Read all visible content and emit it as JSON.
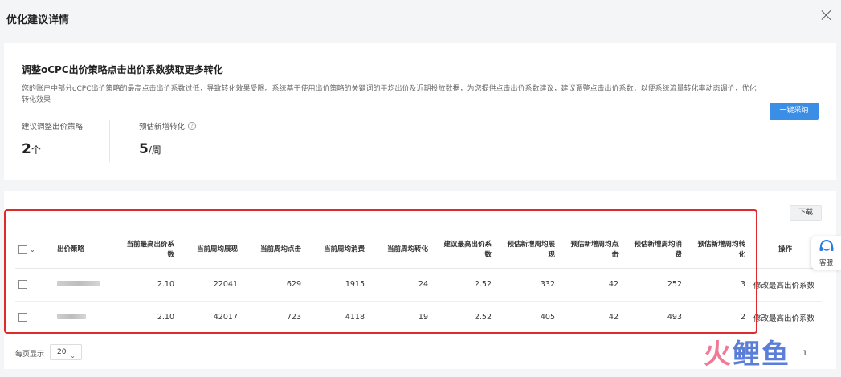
{
  "dialog": {
    "title": "优化建议详情"
  },
  "suggestion": {
    "title": "调整oCPC出价策略点击出价系数获取更多转化",
    "description": "您的账户中部分oCPC出价策略的最高点击出价系数过低，导致转化效果受限。系统基于使用出价策略的关键词的平均出价及近期投放数据，为您提供点击出价系数建议，建议调整点击出价系数，以便系统流量转化率动态调价，优化转化效果",
    "metric1": {
      "label": "建议调整出价策略",
      "value": "2",
      "unit": "个"
    },
    "metric2": {
      "label": "预估新增转化",
      "value": "5",
      "unit": "/周"
    },
    "adopt_label": "一键采纳"
  },
  "table": {
    "download_label": "下载",
    "headers": [
      "出价策略",
      "当前最高出价系数",
      "当前周均展现",
      "当前周均点击",
      "当前周均消费",
      "当前周均转化",
      "建议最高出价系数",
      "预估新增周均展现",
      "预估新增周均点击",
      "预估新增周均消费",
      "预估新增周均转化",
      "操作"
    ],
    "rows": [
      [
        "2.10",
        "22041",
        "629",
        "1915",
        "24",
        "2.52",
        "332",
        "42",
        "252",
        "3",
        "修改最高出价系数"
      ],
      [
        "2.10",
        "42017",
        "723",
        "4118",
        "19",
        "2.52",
        "405",
        "42",
        "493",
        "2",
        "修改最高出价系数"
      ]
    ]
  },
  "pagination": {
    "label": "每页显示",
    "page_size": "20",
    "current_page": "1"
  },
  "customer_service": {
    "label": "客服",
    "icon": "headset-icon"
  },
  "watermark": {
    "part1": "火",
    "part2": "鲤鱼"
  }
}
